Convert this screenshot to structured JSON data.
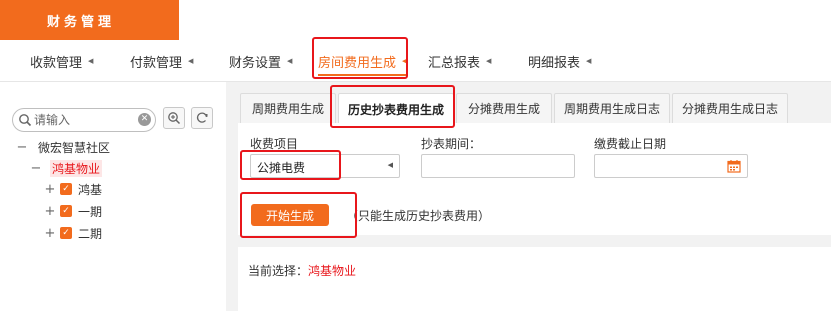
{
  "header": {
    "title": "财务管理"
  },
  "nav": {
    "items": [
      {
        "label": "收款管理"
      },
      {
        "label": "付款管理"
      },
      {
        "label": "财务设置"
      },
      {
        "label": "房间费用生成"
      },
      {
        "label": "汇总报表"
      },
      {
        "label": "明细报表"
      }
    ],
    "active_color": "#f26b1d"
  },
  "sidebar": {
    "search": {
      "placeholder": "请输入",
      "value": ""
    },
    "tree": {
      "root": "微宏智慧社区",
      "selected": "鸿基物业",
      "children": [
        "鸿基",
        "一期",
        "二期"
      ]
    }
  },
  "tabs": [
    {
      "label": "周期费用生成"
    },
    {
      "label": "历史抄表费用生成"
    },
    {
      "label": "分摊费用生成"
    },
    {
      "label": "周期费用生成日志"
    },
    {
      "label": "分摊费用生成日志"
    }
  ],
  "form": {
    "fee_item": {
      "label": "收费项目",
      "value": "公摊电费"
    },
    "reading_period": {
      "label": "抄表期间：",
      "value": ""
    },
    "due_date": {
      "label": "缴费截止日期",
      "value": ""
    },
    "start_button": "开始生成",
    "hint": "（只能生成历史抄表费用）"
  },
  "status": {
    "label": "当前选择：",
    "value": "鸿基物业"
  },
  "colors": {
    "brand": "#f26b1d",
    "highlight_border": "#e8161b"
  }
}
